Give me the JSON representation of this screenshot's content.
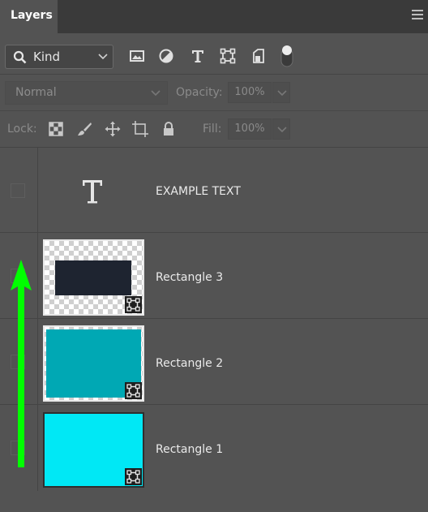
{
  "panel": {
    "tab_label": "Layers",
    "filter": {
      "kind_label": "Kind",
      "icons": [
        "image-filter-icon",
        "adjustment-filter-icon",
        "type-filter-icon",
        "shape-filter-icon",
        "smart-object-filter-icon",
        "filter-toggle"
      ]
    },
    "blend": {
      "mode": "Normal",
      "opacity_label": "Opacity:",
      "opacity_value": "100%"
    },
    "lock": {
      "label": "Lock:",
      "fill_label": "Fill:",
      "fill_value": "100%"
    }
  },
  "layers": [
    {
      "name": "EXAMPLE TEXT",
      "kind": "text",
      "type_glyph": "T"
    },
    {
      "name": "Rectangle 3",
      "kind": "shape",
      "fill": "#1e2430",
      "thumb_bg": "transparent"
    },
    {
      "name": "Rectangle 2",
      "kind": "shape",
      "fill": "#00a8b4",
      "thumb_bg": "transparent"
    },
    {
      "name": "Rectangle 1",
      "kind": "shape",
      "fill": "#00e8f5",
      "thumb_bg": "none"
    }
  ],
  "annotation": {
    "color": "#00ff00",
    "direction": "up"
  },
  "colors": {
    "panel_bg": "#535353",
    "tab_bar_bg": "#3a3a3a"
  }
}
